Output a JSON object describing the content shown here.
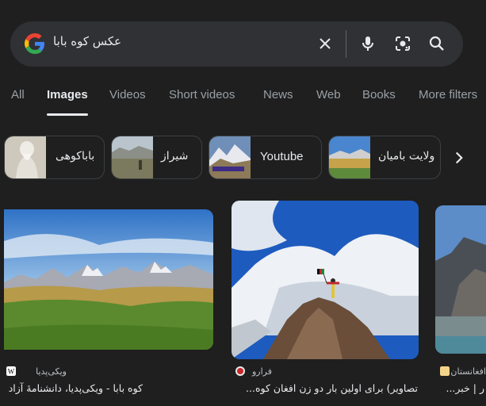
{
  "search": {
    "query": "عکس کوه بابا"
  },
  "icons": {
    "logo": "google-g-logo",
    "clear": "close-icon",
    "voice": "microphone-icon",
    "lens": "camera-lens-icon",
    "search": "search-icon",
    "next": "chevron-right-icon"
  },
  "tabs": [
    "All",
    "Images",
    "Videos",
    "Short videos",
    "News",
    "Web",
    "Books",
    "More filters"
  ],
  "active_tab": "Images",
  "chips": [
    {
      "label": "باباکوهی"
    },
    {
      "label": "شیراز"
    },
    {
      "label": "Youtube"
    },
    {
      "label": "ولایت بامیان"
    }
  ],
  "results": [
    {
      "source": "ویکی‌پدیا",
      "title": "کوه بابا - ویکی‌پدیا، دانشنامهٔ آزاد"
    },
    {
      "source": "فرارو",
      "title": "تصاویر) برای اولین بار دو زن افغان کوه..."
    },
    {
      "source": "افغانستان",
      "title": "ر | خبر..."
    }
  ],
  "colors": {
    "background": "#1f1f1f",
    "searchbar": "#303134",
    "text": "#e8eaed",
    "muted": "#9aa0a6"
  }
}
